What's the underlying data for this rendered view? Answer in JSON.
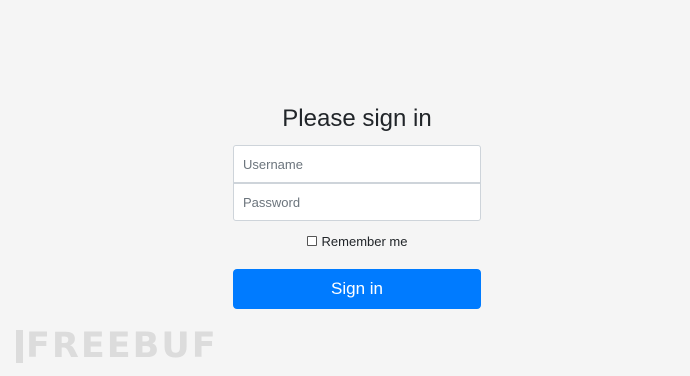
{
  "form": {
    "heading": "Please sign in",
    "username_placeholder": "Username",
    "username_value": "",
    "password_placeholder": "Password",
    "password_value": "",
    "remember_label": "Remember me",
    "remember_checked": false,
    "submit_label": "Sign in"
  },
  "watermark": {
    "text": "FREEBUF"
  },
  "colors": {
    "page_background": "#f5f5f5",
    "primary": "#007bff",
    "border": "#ced4da",
    "watermark": "#dcdcdc"
  }
}
